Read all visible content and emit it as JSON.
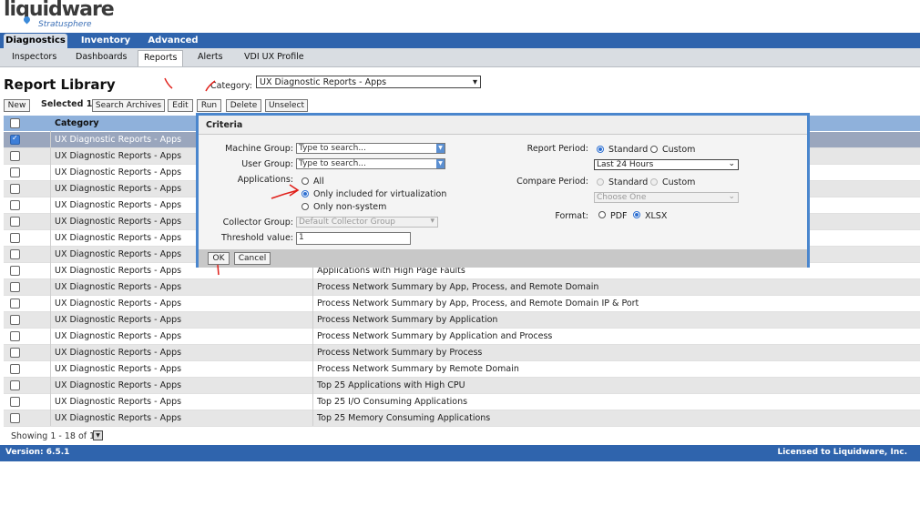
{
  "logo": {
    "word": "liquidware",
    "sub": "Stratusphere"
  },
  "top_nav": [
    {
      "label": "Diagnostics",
      "active": true
    },
    {
      "label": "Inventory",
      "active": false
    },
    {
      "label": "Advanced",
      "active": false
    }
  ],
  "sub_nav": [
    {
      "label": "Inspectors"
    },
    {
      "label": "Dashboards"
    },
    {
      "label": "Reports",
      "active": true
    },
    {
      "label": "Alerts"
    },
    {
      "label": "VDI UX Profile"
    }
  ],
  "page": {
    "title": "Report Library",
    "category_label": "Category:",
    "category_value": "UX Diagnostic Reports - Apps"
  },
  "toolbar": {
    "new": "New",
    "selected": "Selected 1:",
    "search_archives": "Search Archives",
    "edit": "Edit",
    "run": "Run",
    "delete": "Delete",
    "unselect": "Unselect"
  },
  "table": {
    "header": {
      "category": "Category"
    },
    "rows": [
      {
        "category": "UX Diagnostic Reports - Apps",
        "name": "",
        "checked": true
      },
      {
        "category": "UX Diagnostic Reports - Apps",
        "name": "",
        "checked": false
      },
      {
        "category": "UX Diagnostic Reports - Apps",
        "name": "",
        "checked": false
      },
      {
        "category": "UX Diagnostic Reports - Apps",
        "name": "",
        "checked": false
      },
      {
        "category": "UX Diagnostic Reports - Apps",
        "name": "",
        "checked": false
      },
      {
        "category": "UX Diagnostic Reports - Apps",
        "name": "",
        "checked": false
      },
      {
        "category": "UX Diagnostic Reports - Apps",
        "name": "",
        "checked": false
      },
      {
        "category": "UX Diagnostic Reports - Apps",
        "name": "",
        "checked": false
      },
      {
        "category": "UX Diagnostic Reports - Apps",
        "name": "Applications with High Page Faults",
        "checked": false
      },
      {
        "category": "UX Diagnostic Reports - Apps",
        "name": "Process Network Summary by App, Process, and Remote Domain",
        "checked": false
      },
      {
        "category": "UX Diagnostic Reports - Apps",
        "name": "Process Network Summary by App, Process, and Remote Domain IP & Port",
        "checked": false
      },
      {
        "category": "UX Diagnostic Reports - Apps",
        "name": "Process Network Summary by Application",
        "checked": false
      },
      {
        "category": "UX Diagnostic Reports - Apps",
        "name": "Process Network Summary by Application and Process",
        "checked": false
      },
      {
        "category": "UX Diagnostic Reports - Apps",
        "name": "Process Network Summary by Process",
        "checked": false
      },
      {
        "category": "UX Diagnostic Reports - Apps",
        "name": "Process Network Summary by Remote Domain",
        "checked": false
      },
      {
        "category": "UX Diagnostic Reports - Apps",
        "name": "Top 25 Applications with High CPU",
        "checked": false
      },
      {
        "category": "UX Diagnostic Reports - Apps",
        "name": "Top 25 I/O Consuming Applications",
        "checked": false
      },
      {
        "category": "UX Diagnostic Reports - Apps",
        "name": "Top 25 Memory Consuming Applications",
        "checked": false
      }
    ]
  },
  "showing": "Showing 1 - 18 of 18",
  "footer": {
    "version": "Version: 6.5.1",
    "license": "Licensed to Liquidware, Inc."
  },
  "dialog": {
    "title": "Criteria",
    "machine_group_label": "Machine Group:",
    "machine_group_placeholder": "Type to search...",
    "user_group_label": "User Group:",
    "user_group_placeholder": "Type to search...",
    "applications_label": "Applications:",
    "app_options": [
      {
        "label": "All",
        "selected": false
      },
      {
        "label": "Only included for virtualization",
        "selected": true
      },
      {
        "label": "Only non-system",
        "selected": false
      }
    ],
    "collector_group_label": "Collector Group:",
    "collector_group_value": "Default Collector Group",
    "threshold_label": "Threshold value:",
    "threshold_value": "1",
    "report_period_label": "Report Period:",
    "report_period_options": [
      {
        "label": "Standard",
        "selected": true
      },
      {
        "label": "Custom",
        "selected": false
      }
    ],
    "report_period_value": "Last 24 Hours",
    "compare_period_label": "Compare Period:",
    "compare_period_options": [
      {
        "label": "Standard",
        "selected": false
      },
      {
        "label": "Custom",
        "selected": false
      }
    ],
    "compare_period_value": "Choose One",
    "format_label": "Format:",
    "format_options": [
      {
        "label": "PDF",
        "selected": false
      },
      {
        "label": "XLSX",
        "selected": true
      }
    ],
    "ok": "OK",
    "cancel": "Cancel"
  },
  "colors": {
    "nav_blue": "#2f64ad",
    "header_blue": "#8fb1db",
    "dialog_border": "#4a86cd",
    "annotation_red": "#e0201a"
  }
}
